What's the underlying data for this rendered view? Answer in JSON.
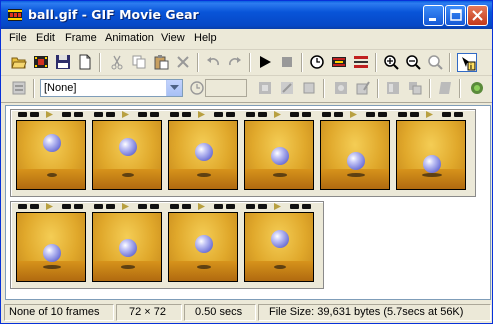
{
  "window": {
    "title": "ball.gif - GIF Movie Gear",
    "controls": [
      "minimize-icon",
      "maximize-icon",
      "close-icon"
    ]
  },
  "menu": [
    "File",
    "Edit",
    "Frame",
    "Animation",
    "View",
    "Help"
  ],
  "toolbar1": [
    "open-icon",
    "movie-icon",
    "save-icon",
    "new-icon",
    "cut-icon",
    "copy-icon",
    "paste-icon",
    "delete-icon",
    "undo-icon",
    "redo-icon",
    "play-icon",
    "stop-icon",
    "clock-icon",
    "film-icon",
    "strip-icon",
    "zoom-in-icon",
    "zoom-out-icon",
    "zoom-reset-icon",
    "help-icon"
  ],
  "toolbar2": {
    "palette_select": "[None]",
    "delay_value": "",
    "icons": [
      "properties-icon",
      "timer-icon",
      "transparency-icon",
      "position-icon",
      "crop-icon",
      "optimize-icon",
      "frame-properties-icon",
      "preview-icon",
      "square-icon",
      "more-icon"
    ]
  },
  "frames": [
    {
      "ball": 0.18,
      "shadow": 0.25
    },
    {
      "ball": 0.3,
      "shadow": 0.35
    },
    {
      "ball": 0.45,
      "shadow": 0.45
    },
    {
      "ball": 0.6,
      "shadow": 0.55
    },
    {
      "ball": 0.75,
      "shadow": 0.7
    },
    {
      "ball": 0.88,
      "shadow": 0.85
    },
    {
      "ball": 0.75,
      "shadow": 0.7
    },
    {
      "ball": 0.6,
      "shadow": 0.55
    },
    {
      "ball": 0.45,
      "shadow": 0.45
    },
    {
      "ball": 0.3,
      "shadow": 0.35
    }
  ],
  "status": {
    "selection": "None of 10 frames",
    "dimensions": "72 × 72",
    "duration": "0.50 secs",
    "filesize": "File Size: 39,631 bytes  (5.7secs at 56K)"
  }
}
